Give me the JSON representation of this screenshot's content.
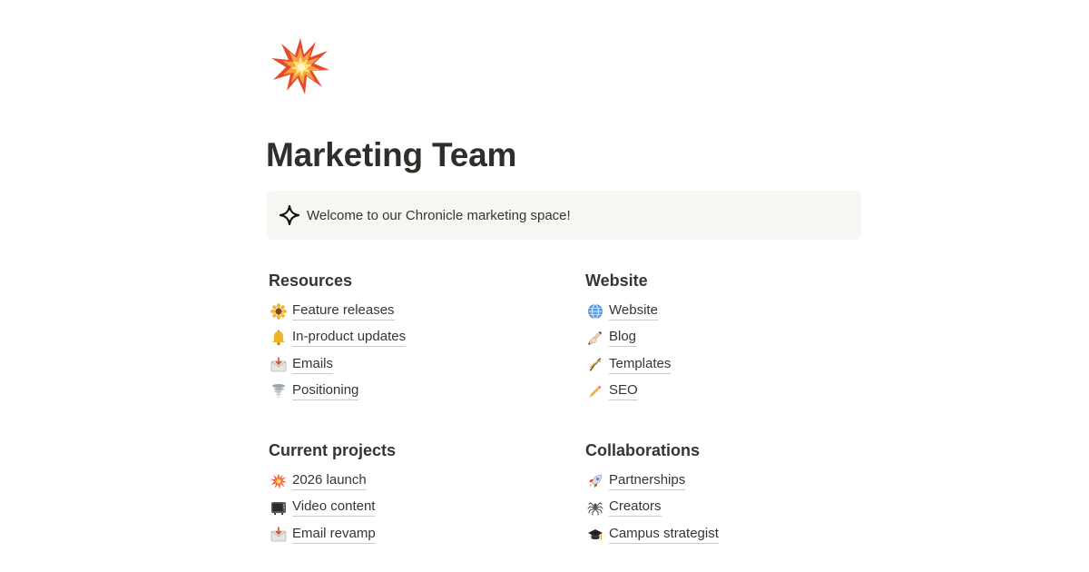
{
  "page": {
    "icon": "collision-icon",
    "title": "Marketing Team"
  },
  "callout": {
    "icon": "sparkle-icon",
    "text": "Welcome to our Chronicle marketing space!"
  },
  "sections": {
    "resources": {
      "heading": "Resources",
      "items": [
        {
          "label": "Feature releases",
          "icon": "sunflower-icon"
        },
        {
          "label": "In-product updates",
          "icon": "bell-icon"
        },
        {
          "label": "Emails",
          "icon": "envelope-icon"
        },
        {
          "label": "Positioning",
          "icon": "tornado-icon"
        }
      ]
    },
    "website": {
      "heading": "Website",
      "items": [
        {
          "label": "Website",
          "icon": "globe-icon"
        },
        {
          "label": "Blog",
          "icon": "writing-hand-icon"
        },
        {
          "label": "Templates",
          "icon": "dna-icon"
        },
        {
          "label": "SEO",
          "icon": "pencil-icon"
        }
      ]
    },
    "current_projects": {
      "heading": "Current projects",
      "items": [
        {
          "label": "2026 launch",
          "icon": "collision-icon"
        },
        {
          "label": "Video content",
          "icon": "television-icon"
        },
        {
          "label": "Email revamp",
          "icon": "envelope-icon"
        }
      ]
    },
    "collaborations": {
      "heading": "Collaborations",
      "items": [
        {
          "label": "Partnerships",
          "icon": "rocket-icon"
        },
        {
          "label": "Creators",
          "icon": "spider-icon"
        },
        {
          "label": "Campus strategist",
          "icon": "graduation-cap-icon"
        }
      ]
    }
  }
}
